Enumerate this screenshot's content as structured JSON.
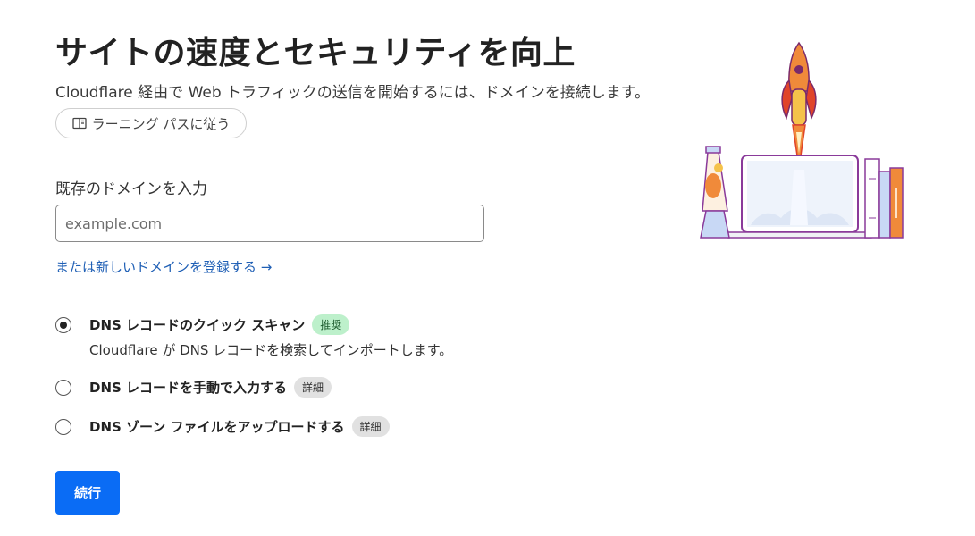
{
  "page": {
    "title": "サイトの速度とセキュリティを向上",
    "subtitle": "Cloudflare 経由で Web トラフィックの送信を開始するには、ドメインを接続します。",
    "learning_path_label": "ラーニング パスに従う"
  },
  "domain_form": {
    "label": "既存のドメインを入力",
    "placeholder": "example.com",
    "value": "",
    "register_link": "または新しいドメインを登録する →"
  },
  "dns_options": [
    {
      "title": "DNS レコードのクイック スキャン",
      "badge": "推奨",
      "description": "Cloudflare が DNS レコードを検索してインポートします。",
      "selected": true
    },
    {
      "title": "DNS レコードを手動で入力する",
      "badge": "詳細",
      "selected": false
    },
    {
      "title": "DNS ゾーン ファイルをアップロードする",
      "badge": "詳細",
      "selected": false
    }
  ],
  "actions": {
    "continue_label": "続行"
  },
  "colors": {
    "primary": "#0a6cf5",
    "link": "#1f5fb5",
    "recommended_badge_bg": "#bdf0cb",
    "detail_badge_bg": "#e1e1e1"
  },
  "icons": {
    "learning_path": "book-icon",
    "illustration": "rocket-laptop-illustration"
  }
}
